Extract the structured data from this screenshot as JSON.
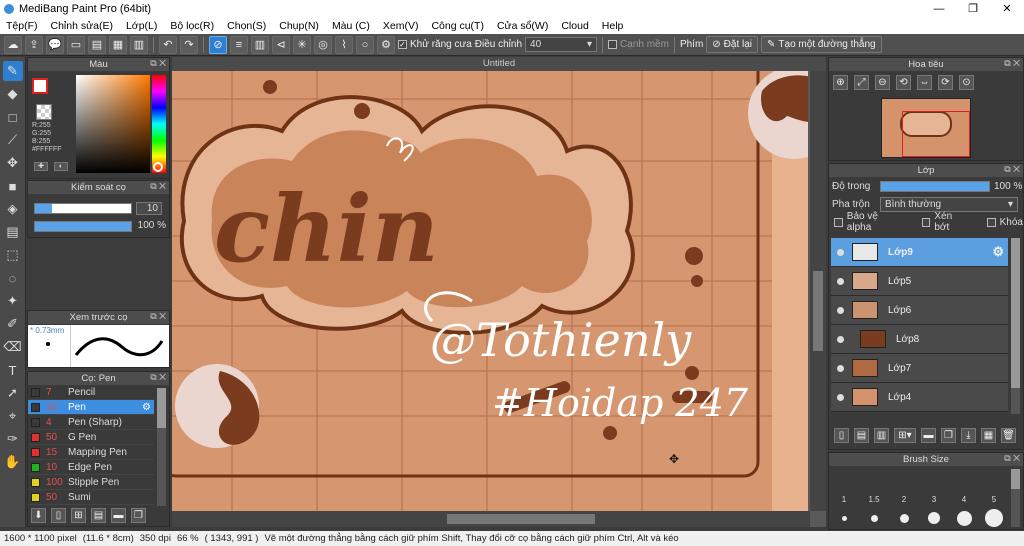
{
  "window": {
    "title": "MediBang Paint Pro (64bit)",
    "controls": [
      "—",
      "❐",
      "✕"
    ]
  },
  "menu": [
    "Tệp(F)",
    "Chỉnh sửa(E)",
    "Lớp(L)",
    "Bộ lọc(R)",
    "Chọn(S)",
    "Chụp(N)",
    "Màu (C)",
    "Xem(V)",
    "Công cụ(T)",
    "Cửa sổ(W)",
    "Cloud",
    "Help"
  ],
  "toolbar": {
    "antialias_label": "Khử răng cưa",
    "adjust_label": "Điều chỉnh",
    "adjust_value": "40",
    "smooth_label": "Cạnh mềm",
    "pen_label": "Phím",
    "reset_label": "Đặt lại",
    "straight_line_label": "Tạo một đường thẳng"
  },
  "color_panel": {
    "title": "Màu",
    "r": "R:255",
    "g": "G:255",
    "b": "B:255",
    "hex": "#FFFFFF"
  },
  "brush_control": {
    "title": "Kiểm soát cọ",
    "size": "10",
    "opacity": "100 %"
  },
  "brush_preview": {
    "title": "Xem trước cọ",
    "size": "0.73mm"
  },
  "brush_list": {
    "title": "Cọ: Pen",
    "items": [
      {
        "size": "7",
        "name": "Pencil",
        "color": "#3a3a3a"
      },
      {
        "size": "10",
        "name": "Pen",
        "color": "#3a3a3a",
        "selected": true
      },
      {
        "size": "4",
        "name": "Pen (Sharp)",
        "color": "#3a3a3a"
      },
      {
        "size": "50",
        "name": "G Pen",
        "color": "#e03030"
      },
      {
        "size": "15",
        "name": "Mapping Pen",
        "color": "#e03030"
      },
      {
        "size": "10",
        "name": "Edge Pen",
        "color": "#20b020"
      },
      {
        "size": "100",
        "name": "Stipple Pen",
        "color": "#e0d020"
      },
      {
        "size": "50",
        "name": "Sumi",
        "color": "#e0d020"
      }
    ]
  },
  "canvas": {
    "doc_title": "Untitled"
  },
  "navigator": {
    "title": "Hoa tiêu"
  },
  "layers": {
    "title": "Lớp",
    "opacity_label": "Độ trong",
    "opacity_value": "100 %",
    "blend_label": "Pha trộn",
    "blend_value": "Bình thường",
    "alpha_label": "Bảo vệ alpha",
    "clip_label": "Xén bớt",
    "lock_label": "Khóa",
    "items": [
      {
        "name": "Lớp9",
        "selected": true,
        "thumb": "#e8e8e8"
      },
      {
        "name": "Lớp5",
        "thumb": "#d9a78a"
      },
      {
        "name": "Lớp6",
        "thumb": "#c9946f"
      },
      {
        "name": "Lớp8",
        "thumb": "#7a3b1f"
      },
      {
        "name": "Lớp7",
        "thumb": "#b06a43"
      },
      {
        "name": "Lớp4",
        "thumb": "#d4936a"
      }
    ]
  },
  "brush_size": {
    "title": "Brush Size",
    "sizes": [
      "1",
      "1.5",
      "2",
      "3",
      "4",
      "5"
    ]
  },
  "status": {
    "dims": "1600 * 1100 pixel",
    "physical": "(11.6 * 8cm)",
    "dpi": "350 dpi",
    "zoom": "66 %",
    "coords": "( 1343, 991 )",
    "hint": "Vẽ một đường thẳng bằng cách giữ phím Shift, Thay đổi cỡ cọ bằng cách giữ phím Ctrl, Alt và kéo"
  },
  "colors": {
    "accent": "#3d8ee0",
    "canvas_bg": "#d4936a",
    "chocolate": "#7a3b1f"
  }
}
